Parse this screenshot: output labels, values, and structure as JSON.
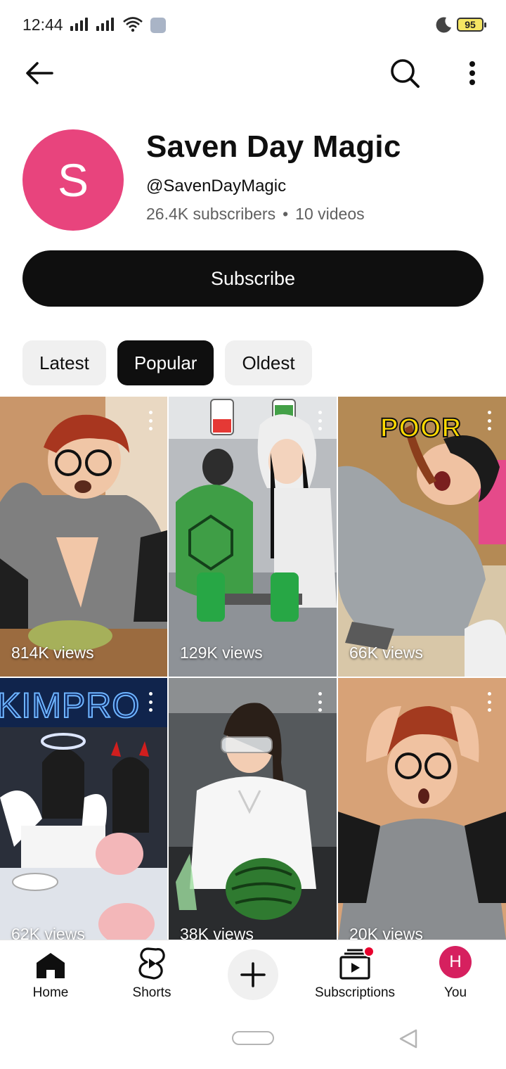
{
  "status_bar": {
    "time": "12:44",
    "battery": "95"
  },
  "header": {
    "back_icon": "arrow-left-icon",
    "search_icon": "search-icon",
    "more_icon": "more-vertical-icon"
  },
  "channel": {
    "avatar_letter": "S",
    "avatar_color": "#e8447d",
    "name": "Saven Day Magic",
    "handle": "@SavenDayMagic",
    "subscribers": "26.4K subscribers",
    "separator": "•",
    "videos": "10 videos",
    "subscribe_label": "Subscribe"
  },
  "filter_chips": [
    {
      "label": "Latest",
      "selected": false
    },
    {
      "label": "Popular",
      "selected": true
    },
    {
      "label": "Oldest",
      "selected": false
    }
  ],
  "shorts": [
    {
      "views": "814K views",
      "overlay": ""
    },
    {
      "views": "129K views",
      "overlay": ""
    },
    {
      "views": "66K views",
      "overlay": "POOR"
    },
    {
      "views": "62K views",
      "overlay": "KIMPRO"
    },
    {
      "views": "38K views",
      "overlay": ""
    },
    {
      "views": "20K views",
      "overlay": ""
    }
  ],
  "bottom_nav": {
    "home": "Home",
    "shorts": "Shorts",
    "create_icon": "plus-icon",
    "subscriptions": "Subscriptions",
    "you": "You",
    "you_avatar_letter": "H"
  }
}
